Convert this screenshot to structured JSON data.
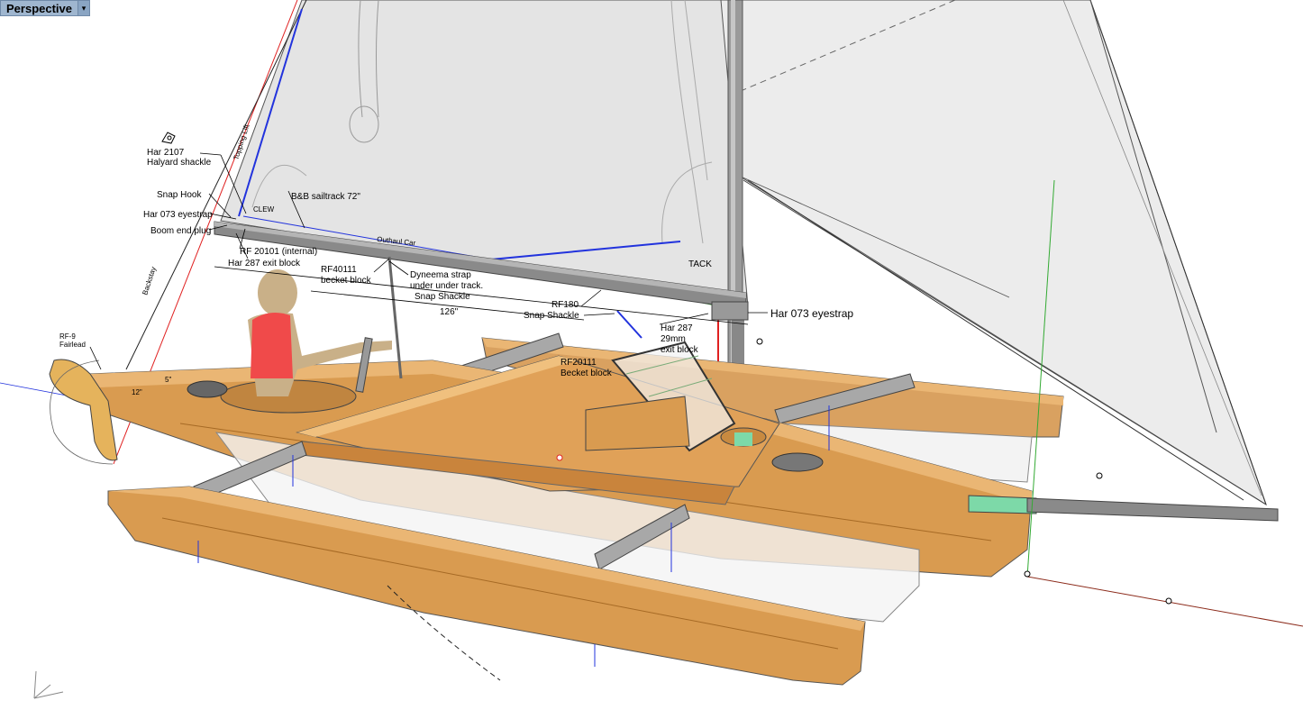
{
  "viewport": {
    "name": "Perspective",
    "menu_icon": "triangle-down-icon"
  },
  "annotations": {
    "har2107": "Har 2107",
    "halyard_shackle": "Halyard shackle",
    "topping_lift": "Topping Lift",
    "snap_hook": "Snap Hook",
    "bb_sailtrack": "B&B sailtrack 72\"",
    "har073_left": "Har 073 eyestrap",
    "clew": "CLEW",
    "boom_end_plug": "Boom end plug",
    "rf20101": "RF 20101 (internal)",
    "har287_exit": "Har 287 exit block",
    "outhaul_car": "Outhaul Car",
    "rf40111": "RF40111",
    "becket_block": "becket block",
    "dyneema1": "Dyneema strap",
    "dyneema2": "under under track.",
    "snap_shackle_a": "Snap Shackle",
    "dim_126": "126\"",
    "rf180": "RF180",
    "snap_shackle_b": "Snap Shackle",
    "tack": "TACK",
    "har073_right": "Har 073 eyestrap",
    "har287_1": "Har 287",
    "har287_2": "29mm",
    "har287_3": "exit block",
    "rf20111_1": "RF20111",
    "rf20111_2": "Becket block",
    "backstay": "Backstay",
    "rf9_1": "RF-9",
    "rf9_2": "Fairlead",
    "dim_5": "5\"",
    "dim_12": "12\""
  },
  "colors": {
    "hull": "#d89a4c",
    "hull_dark": "#b87a30",
    "hull_light": "#eebb77",
    "sail": "#e6e6e6",
    "mast": "#9c9c9c",
    "crew_body": "#c9b088",
    "lifejacket": "#f04a4a",
    "blue_line": "#2233dd",
    "red_line": "#e02020",
    "green_line": "#33aa33",
    "accent_green": "#7dd9a8"
  }
}
